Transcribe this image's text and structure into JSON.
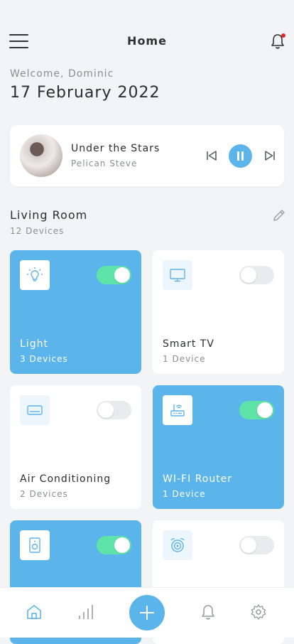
{
  "header": {
    "title": "Home"
  },
  "greeting": {
    "welcome": "Welcome, Dominic",
    "date": "17 February 2022"
  },
  "player": {
    "song": "Under the Stars",
    "artist": "Pelican Steve",
    "state": "playing"
  },
  "room": {
    "name": "Living Room",
    "count": "12 Devices"
  },
  "devices": [
    {
      "name": "Light",
      "count": "3 Devices",
      "on": true,
      "icon": "lightbulb-icon"
    },
    {
      "name": "Smart TV",
      "count": "1 Device",
      "on": false,
      "icon": "monitor-icon"
    },
    {
      "name": "Air Conditioning",
      "count": "2 Devices",
      "on": false,
      "icon": "air-conditioner-icon"
    },
    {
      "name": "WI-FI Router",
      "count": "1 Device",
      "on": true,
      "icon": "router-icon"
    },
    {
      "name": "",
      "count": "",
      "on": true,
      "icon": "speaker-icon"
    },
    {
      "name": "",
      "count": "",
      "on": false,
      "icon": "robot-vacuum-icon"
    }
  ],
  "colors": {
    "accent": "#5bb4ea",
    "toggle_on": "#5ee3a8",
    "notification": "#e0282f"
  }
}
